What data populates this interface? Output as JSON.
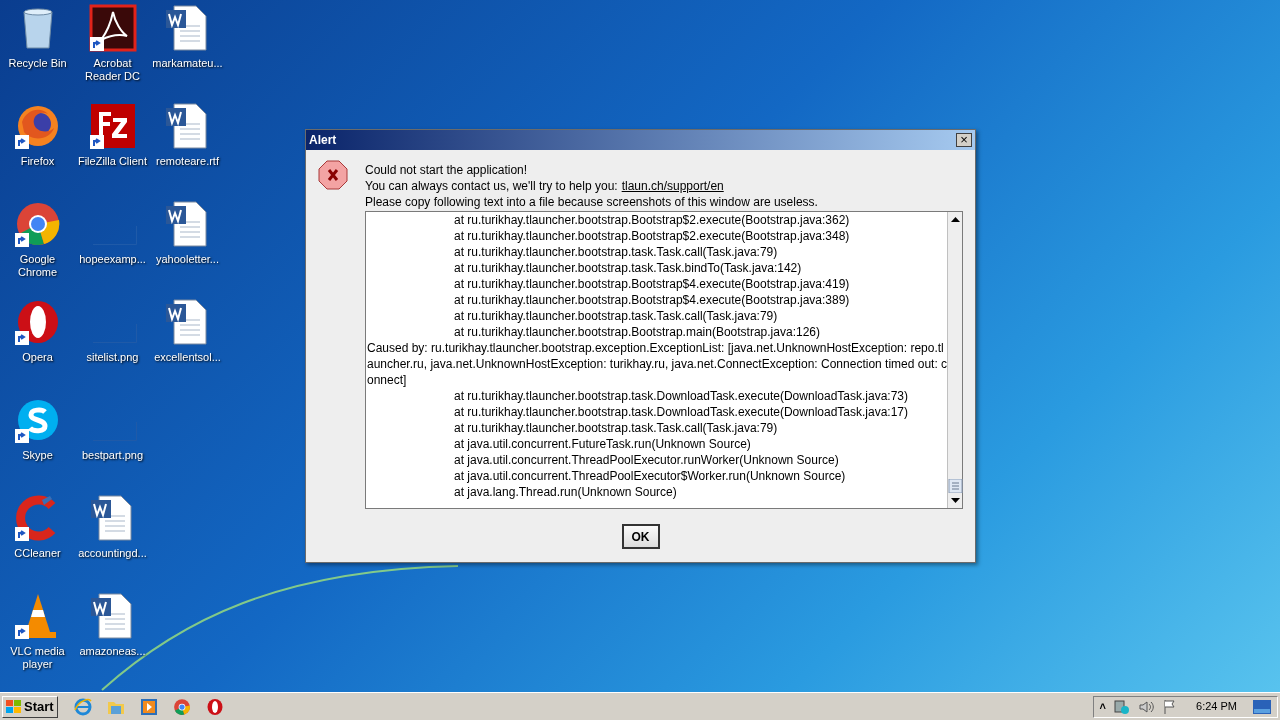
{
  "desktop": {
    "columns": [
      [
        {
          "label": "Recycle Bin",
          "kind": "recycle",
          "shortcut": false
        },
        {
          "label": "Firefox",
          "kind": "firefox",
          "shortcut": true
        },
        {
          "label": "Google Chrome",
          "kind": "chrome",
          "shortcut": true
        },
        {
          "label": "Opera",
          "kind": "opera",
          "shortcut": true
        },
        {
          "label": "Skype",
          "kind": "skype",
          "shortcut": true
        },
        {
          "label": "CCleaner",
          "kind": "ccleaner",
          "shortcut": true
        },
        {
          "label": "VLC media player",
          "kind": "vlc",
          "shortcut": true
        }
      ],
      [
        {
          "label": "Acrobat Reader DC",
          "kind": "acrobat",
          "shortcut": true
        },
        {
          "label": "FileZilla Client",
          "kind": "filezilla",
          "shortcut": true
        },
        {
          "label": "hopeexamp...",
          "kind": "image",
          "shortcut": false
        },
        {
          "label": "sitelist.png",
          "kind": "image",
          "shortcut": false
        },
        {
          "label": "bestpart.png",
          "kind": "image",
          "shortcut": false
        },
        {
          "label": "accountingd...",
          "kind": "document",
          "shortcut": false
        },
        {
          "label": "amazoneas...",
          "kind": "document",
          "shortcut": false
        }
      ],
      [
        {
          "label": "markamateu...",
          "kind": "document",
          "shortcut": false
        },
        {
          "label": "remoteare.rtf",
          "kind": "document",
          "shortcut": false
        },
        {
          "label": "yahooletter...",
          "kind": "document",
          "shortcut": false
        },
        {
          "label": "excellentsol...",
          "kind": "document",
          "shortcut": false
        }
      ]
    ]
  },
  "dialog": {
    "title": "Alert",
    "close": "×",
    "message": "Could not start the application!",
    "contact_text": "You can always contact us, we'll try to help you:",
    "contact_link": "tlaun.ch/support/en",
    "instruction": "Please copy following text into a file because screenshots of this window are useless.",
    "log": [
      {
        "text": "at ru.turikhay.tlauncher.bootstrap.Bootstrap$2.execute(Bootstrap.java:362)",
        "kind": "frame"
      },
      {
        "text": "at ru.turikhay.tlauncher.bootstrap.Bootstrap$2.execute(Bootstrap.java:348)",
        "kind": "frame"
      },
      {
        "text": "at ru.turikhay.tlauncher.bootstrap.task.Task.call(Task.java:79)",
        "kind": "frame"
      },
      {
        "text": "at ru.turikhay.tlauncher.bootstrap.task.Task.bindTo(Task.java:142)",
        "kind": "frame"
      },
      {
        "text": "at ru.turikhay.tlauncher.bootstrap.Bootstrap$4.execute(Bootstrap.java:419)",
        "kind": "frame"
      },
      {
        "text": "at ru.turikhay.tlauncher.bootstrap.Bootstrap$4.execute(Bootstrap.java:389)",
        "kind": "frame"
      },
      {
        "text": "at ru.turikhay.tlauncher.bootstrap.task.Task.call(Task.java:79)",
        "kind": "frame"
      },
      {
        "text": "at ru.turikhay.tlauncher.bootstrap.Bootstrap.main(Bootstrap.java:126)",
        "kind": "frame"
      },
      {
        "text": "Caused by: ru.turikhay.tlauncher.bootstrap.exception.ExceptionList: [java.net.UnknownHostException: repo.tlauncher.ru, java.net.UnknownHostException: turikhay.ru, java.net.ConnectException: Connection timed out: connect]",
        "kind": "cause"
      },
      {
        "text": "at ru.turikhay.tlauncher.bootstrap.task.DownloadTask.execute(DownloadTask.java:73)",
        "kind": "frame"
      },
      {
        "text": "at ru.turikhay.tlauncher.bootstrap.task.DownloadTask.execute(DownloadTask.java:17)",
        "kind": "frame"
      },
      {
        "text": "at ru.turikhay.tlauncher.bootstrap.task.Task.call(Task.java:79)",
        "kind": "frame"
      },
      {
        "text": "at java.util.concurrent.FutureTask.run(Unknown Source)",
        "kind": "frame"
      },
      {
        "text": "at java.util.concurrent.ThreadPoolExecutor.runWorker(Unknown Source)",
        "kind": "frame"
      },
      {
        "text": "at java.util.concurrent.ThreadPoolExecutor$Worker.run(Unknown Source)",
        "kind": "frame"
      },
      {
        "text": "at java.lang.Thread.run(Unknown Source)",
        "kind": "frame"
      }
    ],
    "ok_button": "OK"
  },
  "taskbar": {
    "start": "Start",
    "quick_launch": [
      {
        "kind": "ie"
      },
      {
        "kind": "folder"
      },
      {
        "kind": "media"
      },
      {
        "kind": "chrome"
      },
      {
        "kind": "opera"
      }
    ],
    "tray_expand": "˄",
    "clock": "6:24 PM"
  }
}
